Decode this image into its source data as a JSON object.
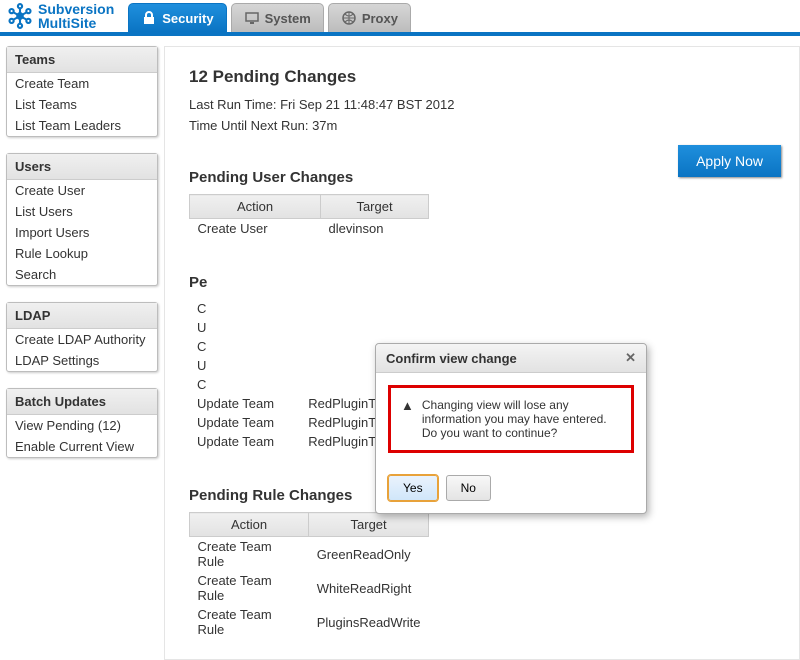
{
  "brand": {
    "line1": "Subversion",
    "line2": "MultiSite"
  },
  "tabs": {
    "security": "Security",
    "system": "System",
    "proxy": "Proxy"
  },
  "sidebar": {
    "teams": {
      "title": "Teams",
      "items": [
        "Create Team",
        "List Teams",
        "List Team Leaders"
      ]
    },
    "users": {
      "title": "Users",
      "items": [
        "Create User",
        "List Users",
        "Import Users",
        "Rule Lookup",
        "Search"
      ]
    },
    "ldap": {
      "title": "LDAP",
      "items": [
        "Create LDAP Authority",
        "LDAP Settings"
      ]
    },
    "batch": {
      "title": "Batch Updates",
      "items": [
        "View Pending (12)",
        "Enable Current View"
      ]
    }
  },
  "page": {
    "title": "12 Pending Changes",
    "last_run_label": "Last Run Time:",
    "last_run_value": "Fri Sep 21 11:48:47 BST 2012",
    "until_next_label": "Time Until Next Run:",
    "until_next_value": "37m",
    "apply_label": "Apply Now"
  },
  "cols": {
    "action": "Action",
    "target": "Target"
  },
  "user_changes": {
    "title": "Pending User Changes",
    "rows": [
      {
        "action": "Create User",
        "target": "dlevinson"
      }
    ]
  },
  "team_changes": {
    "title": "Pending Team Changes",
    "rows": [
      {
        "action": "Create Team",
        "target": ""
      },
      {
        "action": "Update Team",
        "target": ""
      },
      {
        "action": "Create Team",
        "target": ""
      },
      {
        "action": "Update Team",
        "target": ""
      },
      {
        "action": "Create Team",
        "target": ""
      },
      {
        "action": "Update Team",
        "target": "RedPluginTeam"
      },
      {
        "action": "Update Team",
        "target": "RedPluginTeam"
      },
      {
        "action": "Update Team",
        "target": "RedPluginTeam"
      }
    ]
  },
  "rule_changes": {
    "title": "Pending Rule Changes",
    "rows": [
      {
        "action": "Create Team Rule",
        "target": "GreenReadOnly"
      },
      {
        "action": "Create Team Rule",
        "target": "WhiteReadRight"
      },
      {
        "action": "Create Team Rule",
        "target": "PluginsReadWrite"
      }
    ]
  },
  "modal": {
    "title": "Confirm view change",
    "message": "Changing view will lose any information you may have entered. Do you want to continue?",
    "yes": "Yes",
    "no": "No"
  }
}
